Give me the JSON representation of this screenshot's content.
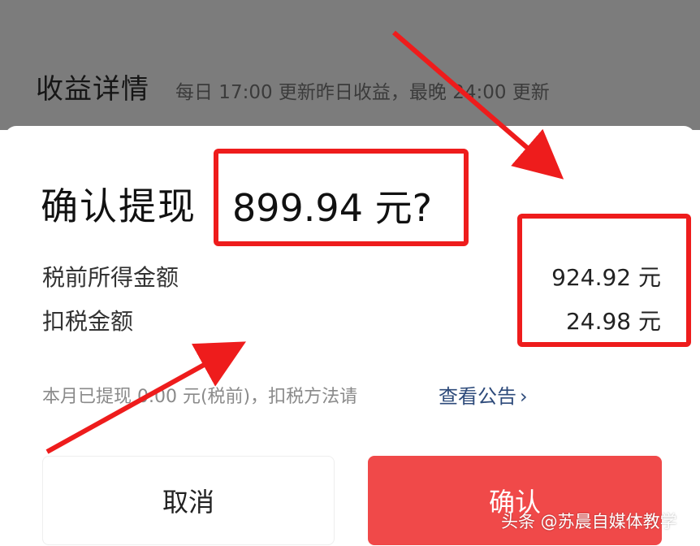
{
  "background": {
    "title": "收益详情",
    "subtitle": "每日 17:00 更新昨日收益，最晚 24:00 更新"
  },
  "dialog": {
    "title_prefix": "确认提现",
    "title_amount": "899.94 元?",
    "rows": [
      {
        "label": "税前所得金额",
        "value": "924.92 元"
      },
      {
        "label": "扣税金额",
        "value": "24.98 元"
      }
    ],
    "note": "本月已提现 0.00 元(税前)，扣税方法请",
    "note_link": "查看公告",
    "cancel_label": "取消",
    "confirm_label": "确认"
  },
  "watermark": "头条 @苏晨自媒体教学",
  "colors": {
    "overlay": "#7c7c7c",
    "confirm": "#f04949",
    "annotation": "#ee1c1c",
    "link": "#2d4a7a"
  }
}
